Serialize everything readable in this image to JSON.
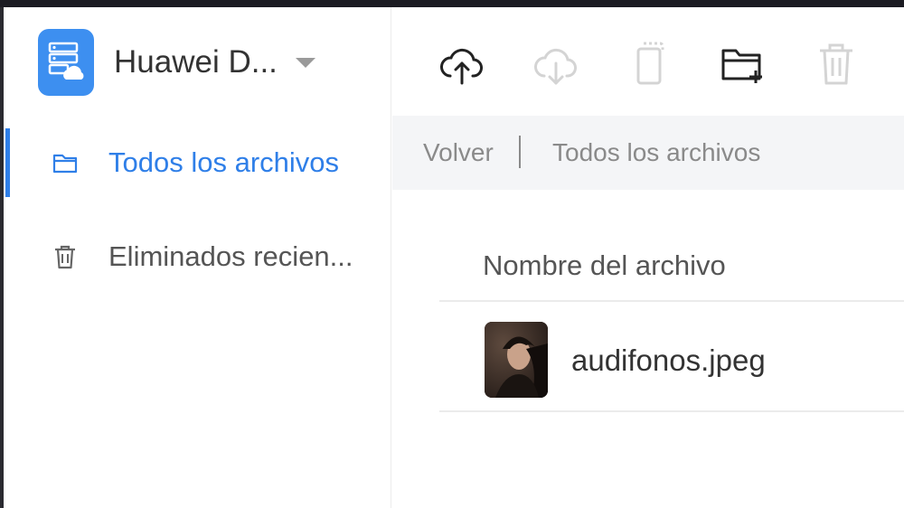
{
  "app": {
    "title": "Huawei D...",
    "accent_color": "#2f7fe8",
    "logo_color": "#3d8ff0",
    "logo_icon": "cloud-drive-icon",
    "switcher_icon": "caret-down-icon"
  },
  "sidebar": {
    "items": [
      {
        "label": "Todos los archivos",
        "icon": "folder-icon",
        "active": true
      },
      {
        "label": "Eliminados recien...",
        "icon": "trash-icon",
        "active": false
      }
    ]
  },
  "toolbar": {
    "buttons": [
      {
        "icon": "cloud-upload-icon",
        "enabled": true
      },
      {
        "icon": "cloud-download-icon",
        "enabled": false
      },
      {
        "icon": "move-to-device-icon",
        "enabled": false
      },
      {
        "icon": "new-folder-icon",
        "enabled": true
      },
      {
        "icon": "delete-icon",
        "enabled": false
      }
    ]
  },
  "breadcrumb": {
    "back_label": "Volver",
    "current_label": "Todos los archivos"
  },
  "file_list": {
    "column_header": "Nombre del archivo",
    "files": [
      {
        "name": "audifonos.jpeg",
        "thumbnail": "photo-thumbnail"
      }
    ]
  }
}
